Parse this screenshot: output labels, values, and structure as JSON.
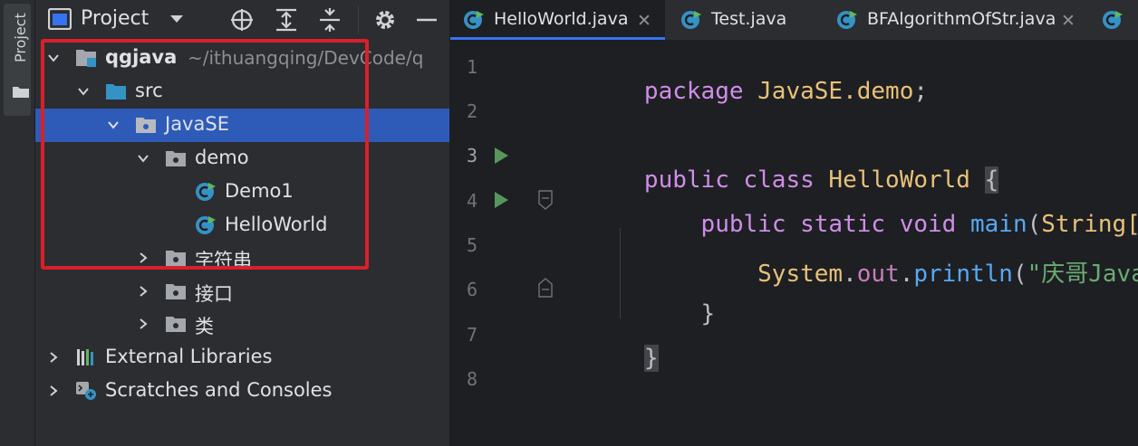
{
  "toolstrip": {
    "project_label": "Project"
  },
  "project_panel": {
    "title": "Project",
    "tree": [
      {
        "label": "qgjava",
        "path": "~/ithuangqing/DevCode/q",
        "icon": "module-icon",
        "expanded": true,
        "bold": true
      },
      {
        "label": "src",
        "icon": "source-folder-icon",
        "expanded": true
      },
      {
        "label": "JavaSE",
        "icon": "package-icon",
        "expanded": true,
        "selected": true
      },
      {
        "label": "demo",
        "icon": "package-icon",
        "expanded": true
      },
      {
        "label": "Demo1",
        "icon": "java-class-icon"
      },
      {
        "label": "HelloWorld",
        "icon": "java-class-icon"
      },
      {
        "label": "字符串",
        "icon": "package-icon",
        "expanded": false
      },
      {
        "label": "接口",
        "icon": "package-icon",
        "expanded": false
      },
      {
        "label": "类",
        "icon": "package-icon",
        "expanded": false
      },
      {
        "label": "External Libraries",
        "icon": "libraries-icon",
        "expanded": false
      },
      {
        "label": "Scratches and Consoles",
        "icon": "scratches-icon",
        "expanded": false
      }
    ]
  },
  "editor": {
    "tabs": [
      {
        "label": "HelloWorld.java",
        "active": true
      },
      {
        "label": "Test.java",
        "active": false
      },
      {
        "label": "BFAlgorithmOfStr.java",
        "active": false
      },
      {
        "label": "",
        "active": false
      }
    ],
    "line_numbers": [
      "1",
      "2",
      "3",
      "4",
      "5",
      "6",
      "7",
      "8"
    ],
    "code": {
      "l1_kw": "package ",
      "l1_pkg": "JavaSE.demo",
      "l1_end": ";",
      "l3_kw1": "public ",
      "l3_kw2": "class ",
      "l3_cls": "HelloWorld ",
      "l3_brace": "{",
      "l4_kw1": "public ",
      "l4_kw2": "static ",
      "l4_kw3": "void ",
      "l4_fn": "main",
      "l4_paren": "(",
      "l4_type": "String[",
      "l5_sys": "System",
      "l5_dot1": ".",
      "l5_out": "out",
      "l5_dot2": ".",
      "l5_fn": "println",
      "l5_paren": "(",
      "l5_str": "\"庆哥Java",
      "l6_brace": "}",
      "l7_brace": "}"
    }
  },
  "colors": {
    "selection": "#2e5bb8",
    "highlight_box": "#d9202a",
    "keyword": "#cf8ee8",
    "type": "#e8c17a",
    "function": "#56a8f5"
  }
}
